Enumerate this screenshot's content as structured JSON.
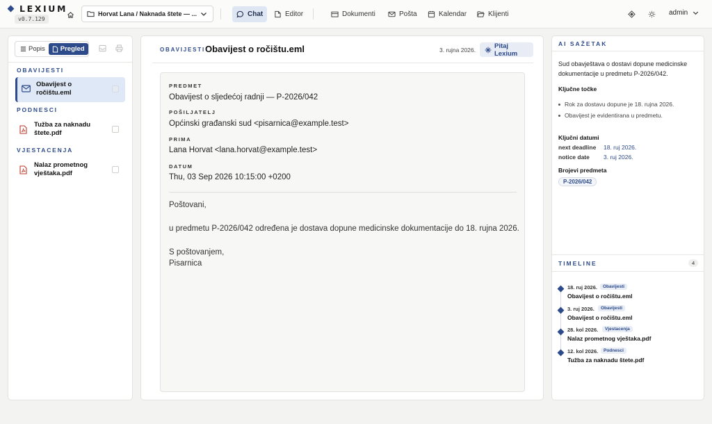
{
  "app": {
    "name": "LEXIUM",
    "version": "v0.7.129"
  },
  "topbar": {
    "matter": "Horvat Lana / Naknada štete — ...",
    "nav": [
      {
        "label": "Chat",
        "icon": "chat-icon",
        "active": true
      },
      {
        "label": "Editor",
        "icon": "pen-icon"
      },
      {
        "label": "Dokumenti",
        "icon": "folder-stack-icon"
      },
      {
        "label": "Pošta",
        "icon": "mail-icon"
      },
      {
        "label": "Kalendar",
        "icon": "calendar-icon"
      },
      {
        "label": "Klijenti",
        "icon": "folder-open-icon"
      }
    ],
    "user": "admin"
  },
  "left": {
    "view": {
      "list_label": "Popis",
      "preview_label": "Pregled",
      "active": "Pregled"
    },
    "groups": [
      {
        "title": "OBAVIJESTI",
        "items": [
          {
            "name": "Obavijest o ročištu.eml",
            "type": "email",
            "selected": true
          }
        ]
      },
      {
        "title": "PODNESCI",
        "items": [
          {
            "name": "Tužba za naknadu štete.pdf",
            "type": "pdf"
          }
        ]
      },
      {
        "title": "VJESTACENJA",
        "items": [
          {
            "name": "Nalaz prometnog vještaka.pdf",
            "type": "pdf"
          }
        ]
      }
    ]
  },
  "center": {
    "breadcrumb": "OBAVIJESTI",
    "title": "Obavijest o ročištu.eml",
    "date": "3. rujna 2026.",
    "ask_button": "Pitaj Lexium",
    "email": {
      "subject_label": "PREDMET",
      "subject": "Obavijest o sljedećoj radnji — P-2026/042",
      "sender_label": "POŠILJATELJ",
      "sender": "Općinski građanski sud <pisarnica@example.test>",
      "recipient_label": "PRIMA",
      "recipient": "Lana Horvat <lana.horvat@example.test>",
      "date_label": "DATUM",
      "date": "Thu, 03 Sep 2026 10:15:00 +0200",
      "body": [
        "Poštovani,",
        "u predmetu P-2026/042 određena je dostava dopune medicinske dokumentacije do 18. rujna 2026.",
        "S poštovanjem,",
        "Pisarnica"
      ]
    }
  },
  "right": {
    "summary_title": "AI SAŽETAK",
    "summary": "Sud obavještava o dostavi dopune medicinske dokumentacije u predmetu P-2026/042.",
    "key_points_title": "Ključne točke",
    "key_points": [
      "Rok za dostavu dopune je 18. rujna 2026.",
      "Obavijest je evidentirana u predmetu."
    ],
    "key_dates_title": "Ključni datumi",
    "key_dates": [
      {
        "label": "next deadline",
        "value": "18. ruj 2026."
      },
      {
        "label": "notice date",
        "value": "3. ruj 2026."
      }
    ],
    "case_numbers_title": "Brojevi predmeta",
    "case_numbers": [
      "P-2026/042"
    ],
    "timeline_title": "TIMELINE",
    "timeline_count": "4",
    "timeline": [
      {
        "date": "18. ruj 2026.",
        "category": "Obavijesti",
        "title": "Obavijest o ročištu.eml"
      },
      {
        "date": "3. ruj 2026.",
        "category": "Obavijesti",
        "title": "Obavijest o ročištu.eml"
      },
      {
        "date": "28. kol 2026.",
        "category": "Vjestacenja",
        "title": "Nalaz prometnog vještaka.pdf"
      },
      {
        "date": "12. kol 2026.",
        "category": "Podnesci",
        "title": "Tužba za naknadu štete.pdf"
      }
    ]
  },
  "colors": {
    "accent": "#2d4a8a",
    "pdf": "#c0392b"
  }
}
